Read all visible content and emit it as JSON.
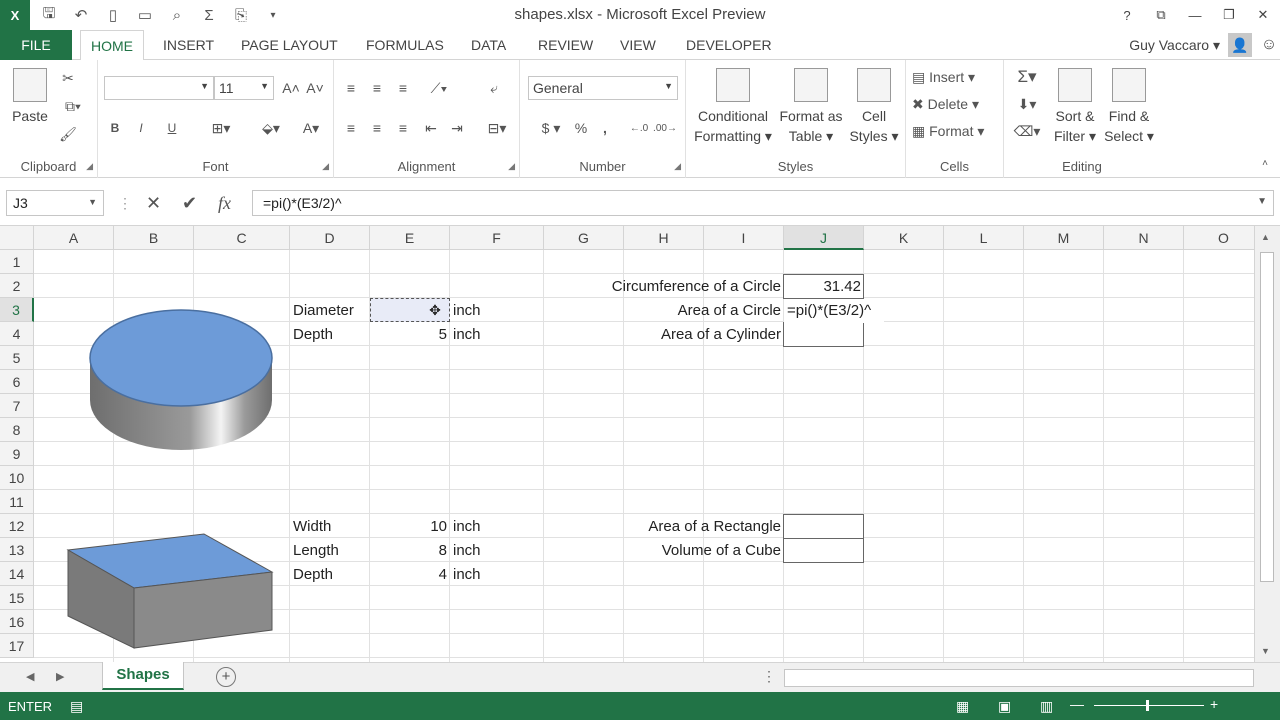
{
  "app": {
    "logo": "X",
    "title": "shapes.xlsx - Microsoft Excel Preview"
  },
  "window_controls": {
    "help": "?",
    "ribbon_display": "⧉",
    "minimize": "—",
    "restore": "❐",
    "close": "✕"
  },
  "quick_access": [
    "save-icon",
    "undo-icon",
    "new-icon",
    "open-icon",
    "print-preview-icon",
    "sum-icon",
    "format-icon",
    "customize-icon"
  ],
  "tabs": {
    "file": "FILE",
    "items": [
      "HOME",
      "INSERT",
      "PAGE LAYOUT",
      "FORMULAS",
      "DATA",
      "REVIEW",
      "VIEW",
      "DEVELOPER"
    ],
    "active": "HOME"
  },
  "user": {
    "name": "Guy Vaccaro ▾"
  },
  "ribbon": {
    "clipboard": {
      "label": "Clipboard",
      "paste": "Paste"
    },
    "font": {
      "label": "Font",
      "font_name": "",
      "font_size": "11",
      "bold": "B",
      "italic": "I",
      "underline": "U",
      "font_color": "A"
    },
    "alignment": {
      "label": "Alignment"
    },
    "number": {
      "label": "Number",
      "format": "General",
      "currency": "$",
      "percent": "%",
      "comma": ","
    },
    "styles": {
      "label": "Styles",
      "conditional": [
        "Conditional",
        "Formatting ▾"
      ],
      "format_table": [
        "Format as",
        "Table ▾"
      ],
      "cell_styles": [
        "Cell",
        "Styles ▾"
      ]
    },
    "cells": {
      "label": "Cells",
      "insert": "Insert",
      "delete": "Delete",
      "format": "Format"
    },
    "editing": {
      "label": "Editing",
      "sort": [
        "Sort &",
        "Filter ▾"
      ],
      "find": [
        "Find &",
        "Select ▾"
      ]
    }
  },
  "formula_bar": {
    "name_box": "J3",
    "formula": "=pi()*(E3/2)^",
    "cancel": "✕",
    "enter": "✔",
    "fx": "fx"
  },
  "columns": [
    "A",
    "B",
    "C",
    "D",
    "E",
    "F",
    "G",
    "H",
    "I",
    "J",
    "K",
    "L",
    "M",
    "N",
    "O"
  ],
  "rows": [
    "1",
    "2",
    "3",
    "4",
    "5",
    "6",
    "7",
    "8",
    "9",
    "10",
    "11",
    "12",
    "13",
    "14",
    "15",
    "16",
    "17"
  ],
  "selected": {
    "column": "J",
    "row": "3"
  },
  "cells": {
    "d3": "Diameter",
    "f3": "inch",
    "d4": "Depth",
    "e4": "5",
    "f4": "inch",
    "d12": "Width",
    "e12": "10",
    "f12": "inch",
    "d13": "Length",
    "e13": "8",
    "f13": "inch",
    "d14": "Depth",
    "e14": "4",
    "f14": "inch",
    "i2": "Circumference of a Circle",
    "j2": "31.42",
    "i3": "Area of a Circle",
    "j3": "=pi()*(E3/2)^",
    "i4": "Area of a Cylinder",
    "i12": "Area of a Rectangle",
    "i13": "Volume of a Cube"
  },
  "sheet_tabs": {
    "active": "Shapes",
    "add": "+"
  },
  "status": {
    "mode": "ENTER"
  },
  "colors": {
    "accent": "#217346",
    "shape_fill": "#6d9bd8",
    "shape_side": "#8a8a8a"
  }
}
